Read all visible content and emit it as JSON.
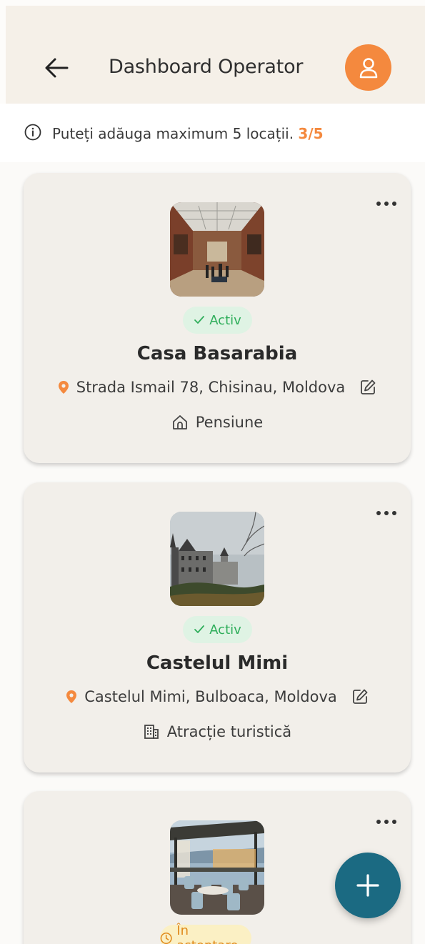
{
  "header": {
    "title": "Dashboard Operator",
    "back_icon": "arrow-left-icon",
    "profile_icon": "user-icon",
    "accent_color": "#f4893e"
  },
  "limit_notice": {
    "text": "Puteți adăuga maximum 5 locații.",
    "count": "3/5"
  },
  "locations": [
    {
      "name": "Casa Basarabia",
      "status": "Activ",
      "status_icon": "check-icon",
      "address": "Strada Ismail 78, Chisinau, Moldova",
      "type": "Pensiune",
      "type_icon": "home-icon"
    },
    {
      "name": "Castelul Mimi",
      "status": "Activ",
      "status_icon": "check-icon",
      "address": "Castelul Mimi, Bulboaca, Moldova",
      "type": "Atracție turistică",
      "type_icon": "building-icon"
    },
    {
      "name": "",
      "status": "În asteptare",
      "status_icon": "clock-icon"
    }
  ],
  "fab": {
    "icon": "plus-icon",
    "color": "#1b6a82"
  }
}
